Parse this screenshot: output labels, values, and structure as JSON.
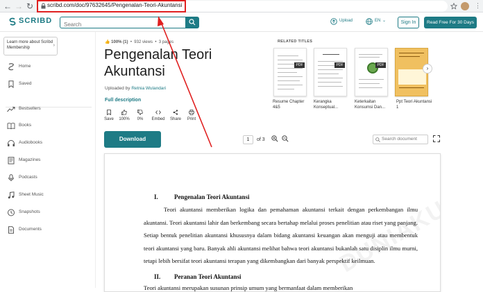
{
  "browser": {
    "url": "scribd.com/doc/97632645/Pengenalan-Teori-Akuntansi",
    "back": "←",
    "forward": "→",
    "reload": "↻"
  },
  "header": {
    "logo": "SCRIBD",
    "search_placeholder": "Search",
    "upload": "Upload",
    "language": "EN",
    "signin": "Sign In",
    "read_free": "Read Free For 30 Days"
  },
  "sidebar": {
    "membership": "Learn more about Scribd Membership",
    "items": [
      {
        "label": "Home",
        "icon": "home-icon"
      },
      {
        "label": "Saved",
        "icon": "bookmark-icon"
      },
      {
        "label": "Bestsellers",
        "icon": "trending-icon"
      },
      {
        "label": "Books",
        "icon": "book-icon"
      },
      {
        "label": "Audiobooks",
        "icon": "headphones-icon"
      },
      {
        "label": "Magazines",
        "icon": "magazine-icon"
      },
      {
        "label": "Podcasts",
        "icon": "podcast-icon"
      },
      {
        "label": "Sheet Music",
        "icon": "music-note-icon"
      },
      {
        "label": "Snapshots",
        "icon": "snapshot-icon"
      },
      {
        "label": "Documents",
        "icon": "document-icon"
      }
    ]
  },
  "document": {
    "rating": "100% (1)",
    "views": "932 views",
    "pages_count": "3 pages",
    "title": "Pengenalan Teori Akuntansi",
    "uploaded_by_label": "Uploaded by",
    "uploader": "Retnia Wulandari",
    "full_description": "Full description",
    "actions": [
      {
        "label": "Save",
        "icon": "bookmark-icon"
      },
      {
        "label": "100%",
        "icon": "thumbs-up-icon"
      },
      {
        "label": "0%",
        "icon": "thumbs-down-icon"
      },
      {
        "label": "Embed",
        "icon": "code-icon"
      },
      {
        "label": "Share",
        "icon": "share-icon"
      },
      {
        "label": "Print",
        "icon": "print-icon"
      }
    ],
    "download": "Download"
  },
  "related": {
    "heading": "RELATED TITLES",
    "items": [
      {
        "caption": "Resume Chapter 4&5",
        "badge": "PDF"
      },
      {
        "caption": "Kerangka Konseptual...",
        "badge": "PDF"
      },
      {
        "caption": "Keterkaitan Konsumsi Dan...",
        "badge": "PDF"
      },
      {
        "caption": "Ppt Teori Akuntansi 1",
        "badge": ""
      }
    ]
  },
  "viewer": {
    "page": "1",
    "of_pages": "of 3",
    "search_placeholder": "Search document"
  },
  "content": {
    "h1_num": "I.",
    "h1": "Pengenalan Teori Akuntansi",
    "p1": "Teori akuntansi memberikan logika dan pemahaman akuntansi terkait dengan perkembangan ilmu akuntansi. Teori akuntansi lahir dan berkembang secara bertahap melalui proses penelitian atau riset yang panjang. Setiap bentuk penelitian akuntansi khususnya dalam bidang akuntansi keuangan akan menguji atau membentuk teori akuntansi yang baru. Banyak ahli akuntansi melihat bahwa teori akuntansi bukanlah satu disiplin ilmu murni, tetapi lebih bersifat teori akuntansi terapan yang dikembangkan dari banyak perspektif keilmuan.",
    "h2_num": "II.",
    "h2": "Peranan Teori Akuntansi",
    "p2": "Teori akuntansi merupakan susunan prinsip umum yang bermanfaat dalam memberikan"
  },
  "watermark": "DUNIAKU",
  "colors": {
    "brand": "#1e7b85",
    "annotation": "#e02020"
  }
}
